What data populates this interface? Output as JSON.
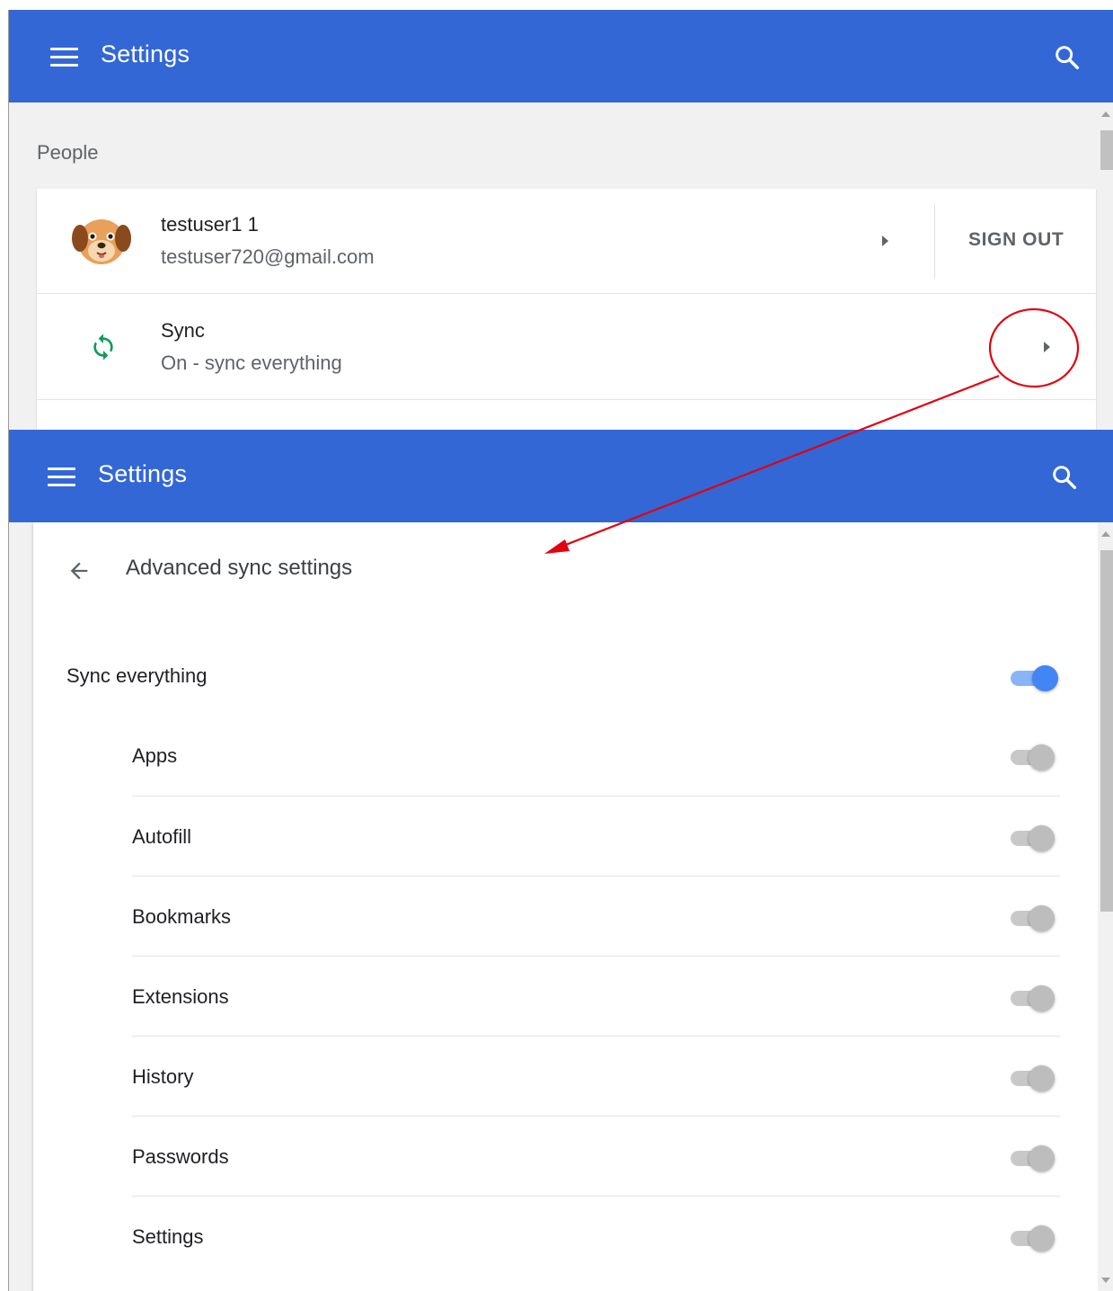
{
  "colors": {
    "app_bar": "#3367d6",
    "toggle_on": "#4285f4",
    "toggle_off": "#bdbdbd",
    "sync_icon": "#0f9d58",
    "annotation": "#e3000f"
  },
  "top_window": {
    "app_bar": {
      "title": "Settings",
      "menu_icon": "hamburger-menu-icon",
      "search_icon": "search-icon"
    },
    "section_title": "People",
    "profile": {
      "name": "testuser1 1",
      "email": "testuser720@gmail.com",
      "avatar_icon": "dog-avatar-icon",
      "sign_out_label": "SIGN OUT"
    },
    "sync": {
      "title": "Sync",
      "status": "On - sync everything",
      "icon": "sync-icon"
    }
  },
  "bottom_window": {
    "app_bar": {
      "title": "Settings",
      "menu_icon": "hamburger-menu-icon",
      "search_icon": "search-icon"
    },
    "subpage_title": "Advanced sync settings",
    "sync_everything": {
      "label": "Sync everything",
      "on": true
    },
    "items": [
      {
        "label": "Apps",
        "on": false
      },
      {
        "label": "Autofill",
        "on": false
      },
      {
        "label": "Bookmarks",
        "on": false
      },
      {
        "label": "Extensions",
        "on": false
      },
      {
        "label": "History",
        "on": false
      },
      {
        "label": "Passwords",
        "on": false
      },
      {
        "label": "Settings",
        "on": false
      }
    ]
  }
}
